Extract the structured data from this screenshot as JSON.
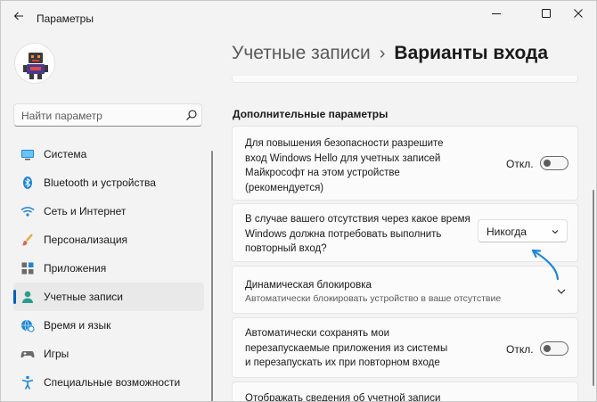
{
  "window": {
    "title": "Параметры",
    "controls": [
      "minimize-icon",
      "maximize-icon",
      "close-icon"
    ]
  },
  "search": {
    "placeholder": "Найти параметр"
  },
  "sidebar": {
    "items": [
      {
        "label": "Система",
        "icon": "system-icon",
        "active": false
      },
      {
        "label": "Bluetooth и устройства",
        "icon": "bluetooth-icon",
        "active": false
      },
      {
        "label": "Сеть и Интернет",
        "icon": "wifi-icon",
        "active": false
      },
      {
        "label": "Персонализация",
        "icon": "brush-icon",
        "active": false
      },
      {
        "label": "Приложения",
        "icon": "apps-icon",
        "active": false
      },
      {
        "label": "Учетные записи",
        "icon": "account-icon",
        "active": true
      },
      {
        "label": "Время и язык",
        "icon": "globe-clock-icon",
        "active": false
      },
      {
        "label": "Игры",
        "icon": "gamepad-icon",
        "active": false
      },
      {
        "label": "Специальные возможности",
        "icon": "accessibility-icon",
        "active": false
      }
    ]
  },
  "breadcrumb": {
    "parent": "Учетные записи",
    "separator": "›",
    "current": "Варианты входа"
  },
  "main": {
    "section_title": "Дополнительные параметры",
    "cards": [
      {
        "lines": [
          "Для повышения безопасности разрешите",
          "вход Windows Hello для учетных записей",
          "Майкрософт на этом устройстве",
          "(рекомендуется)"
        ],
        "toggle_state": "Откл.",
        "toggle_on": false
      },
      {
        "lines": [
          "В случае вашего отсутствия через какое время",
          "Windows должна потребовать выполнить",
          "повторный вход?"
        ],
        "dropdown_value": "Никогда"
      },
      {
        "title": "Динамическая блокировка",
        "description": "Автоматически блокировать устройство в ваше отсутствие"
      },
      {
        "lines": [
          "Автоматически сохранять мои",
          "перезапускаемые приложения из системы",
          "и перезапускать их при повторном входе"
        ],
        "toggle_state": "Откл.",
        "toggle_on": false
      },
      {
        "lines": [
          "Отображать сведения об учетной записи"
        ]
      }
    ]
  },
  "colors": {
    "accent": "#005fb8",
    "annotation_arrow": "#1f86d6",
    "background": "#f3f3f3",
    "card": "#fbfbfb"
  }
}
